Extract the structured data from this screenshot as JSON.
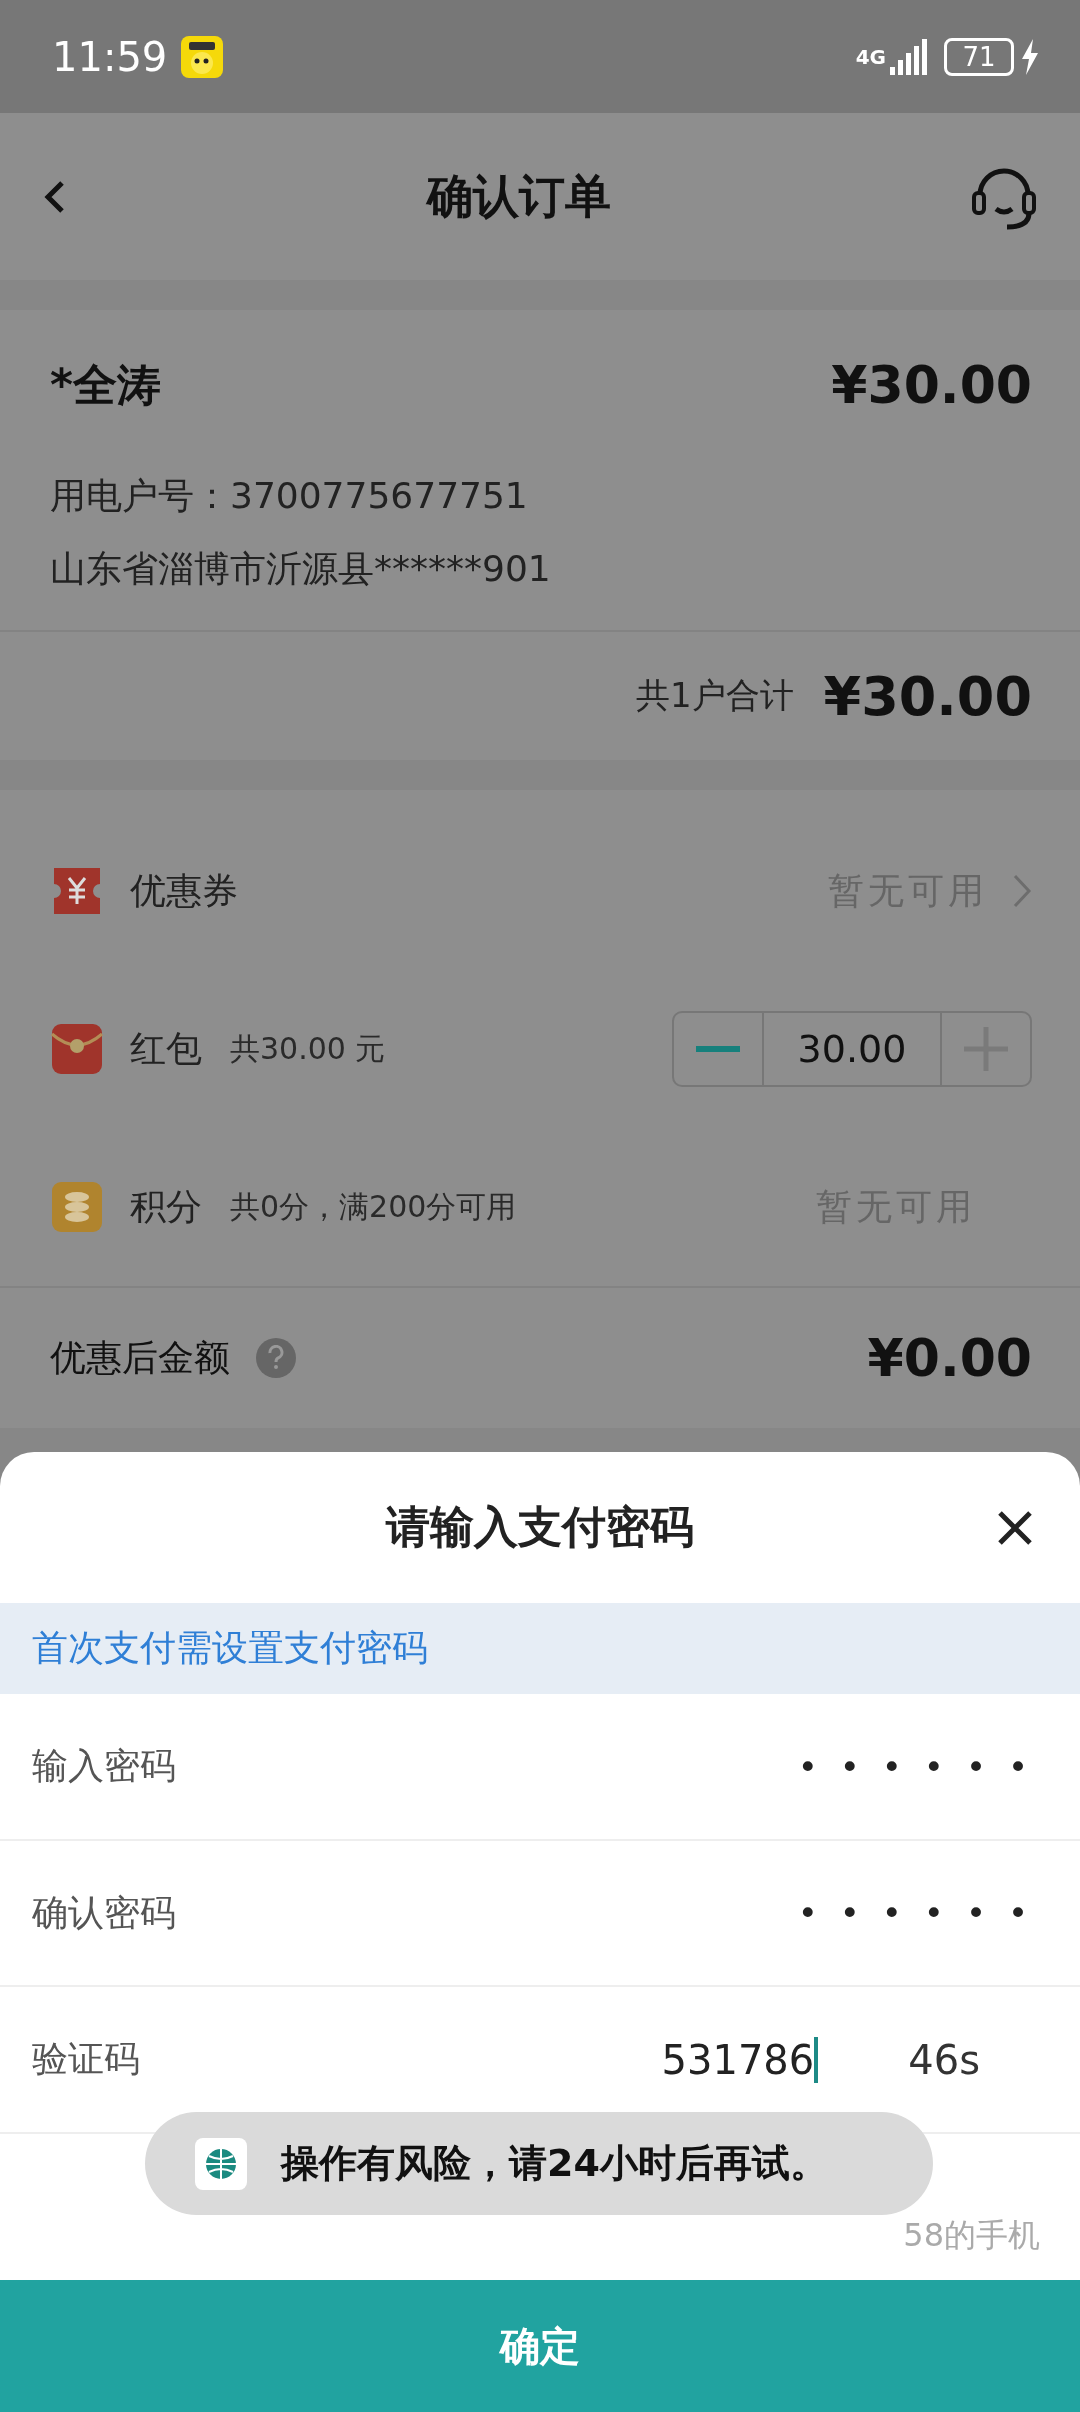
{
  "status_bar": {
    "time": "11:59",
    "network": "4G",
    "battery": "71"
  },
  "nav": {
    "title": "确认订单"
  },
  "account": {
    "name": "*全涛",
    "amount": "¥30.00",
    "details": [
      "用电户号：3700775677751",
      "山东省淄博市沂源县******901"
    ],
    "total_label": "共1户合计",
    "total": "¥30.00"
  },
  "discounts": [
    {
      "kind": "coupon",
      "label": "优惠券",
      "status": "暂无可用"
    },
    {
      "kind": "redpacket",
      "label": "红包",
      "note": "共30.00 元",
      "value": "30.00",
      "can_decrease": true,
      "can_increase": false
    },
    {
      "kind": "points",
      "label": "积分",
      "note": "共0分，满200分可用",
      "status": "暂无可用"
    }
  ],
  "after_discount": {
    "label": "优惠后金额",
    "amount": "¥0.00"
  },
  "sheet": {
    "title": "请输入支付密码",
    "notice": "首次支付需设置支付密码",
    "fields": [
      {
        "label": "输入密码",
        "value": "••••••"
      },
      {
        "label": "确认密码",
        "value": "••••••"
      },
      {
        "label": "验证码",
        "value": "531786",
        "countdown": "46s"
      }
    ],
    "hint": "58的手机",
    "button": "确定"
  },
  "toast": {
    "message": "操作有风险，请24小时后再试。"
  }
}
